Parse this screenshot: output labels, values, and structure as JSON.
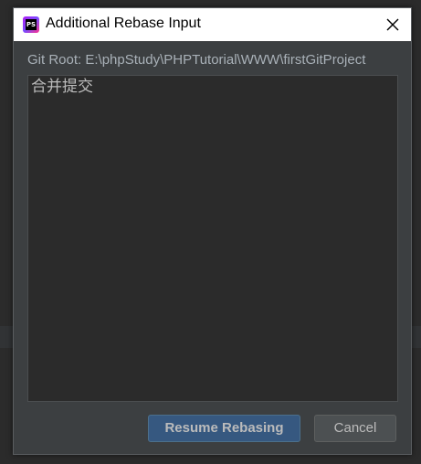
{
  "dialog": {
    "title": "Additional Rebase Input",
    "app_icon": "phpstorm-icon",
    "app_icon_letters": "PS",
    "close_icon": "close-icon",
    "git_root_label": "Git Root: E:\\phpStudy\\PHPTutorial\\WWW\\firstGitProject",
    "input_value": "合并提交",
    "resume_button": "Resume Rebasing",
    "cancel_button": "Cancel"
  },
  "colors": {
    "dialog_bg": "#3c3f41",
    "editor_bg": "#2b2b2b",
    "primary_button": "#365880",
    "secondary_button": "#4c5052",
    "text": "#bbbbbb"
  }
}
